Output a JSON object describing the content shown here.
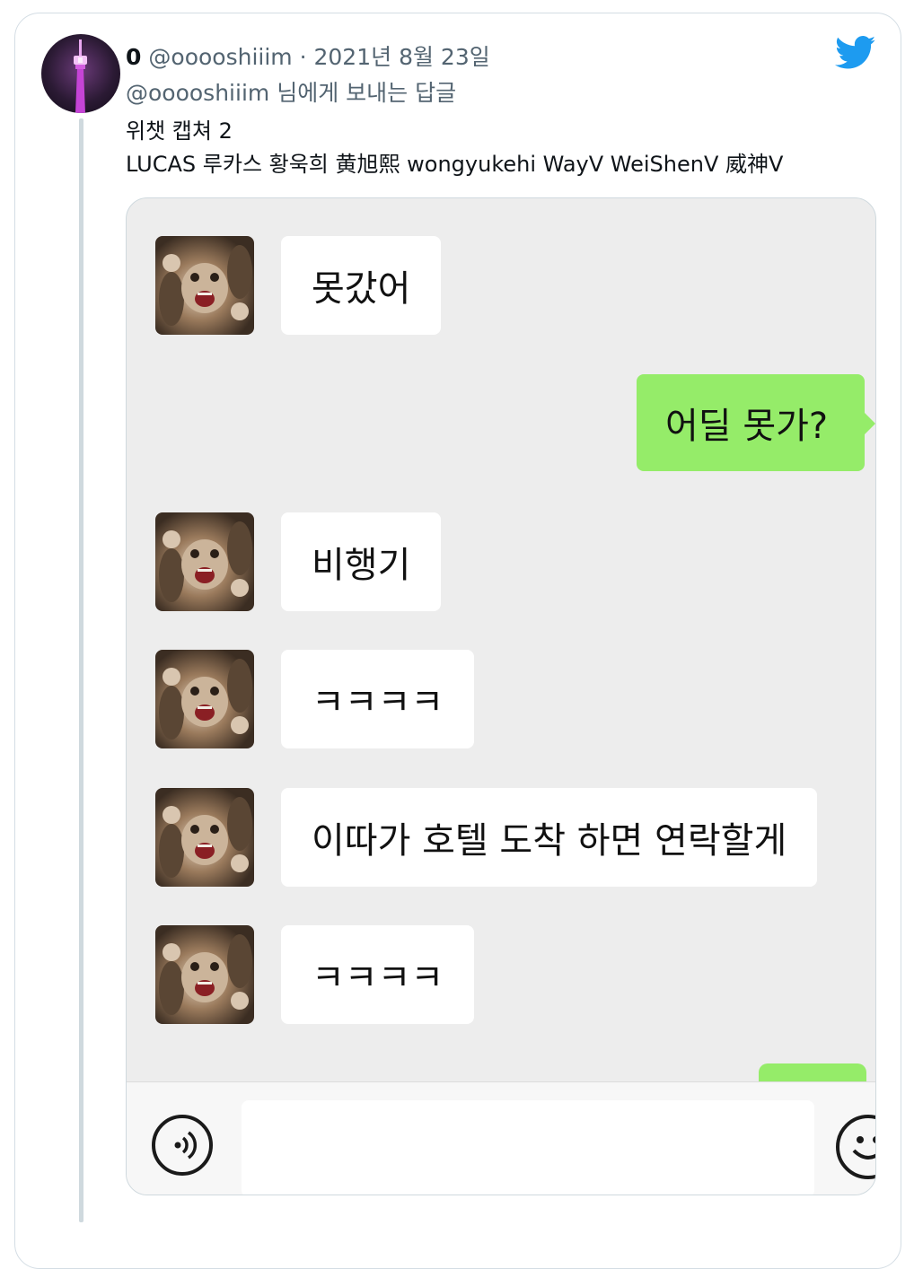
{
  "tweet": {
    "display_name": "0",
    "handle": "@ooooshiiim",
    "separator": " · ",
    "date": "2021년 8월 23일",
    "reply_to": "@ooooshiiim 님에게 보내는 답글",
    "text_line1": "위챗 캡쳐 2",
    "text_line2": "LUCAS 루카스 황욱희 黄旭熙 wongyukehi WayV WeiShenV 威神V"
  },
  "chat": {
    "messages": [
      {
        "side": "in",
        "text": "못갔어"
      },
      {
        "side": "out",
        "text": "어딜 못가?"
      },
      {
        "side": "in",
        "text": "비행기"
      },
      {
        "side": "in",
        "text": "ㅋㅋㅋㅋ"
      },
      {
        "side": "in",
        "text": "이따가 호텔 도착 하면 연락할게"
      },
      {
        "side": "in",
        "text": "ㅋㅋㅋㅋ"
      }
    ],
    "input_placeholder": ""
  },
  "icons": {
    "brand": "twitter-bird-icon",
    "voice": "voice-wave-icon",
    "emoji": "emoji-face-icon"
  },
  "colors": {
    "twitter_blue": "#1d9bf0",
    "bubble_out": "#95ec69",
    "bubble_in": "#ffffff",
    "chat_bg": "#ededed"
  }
}
